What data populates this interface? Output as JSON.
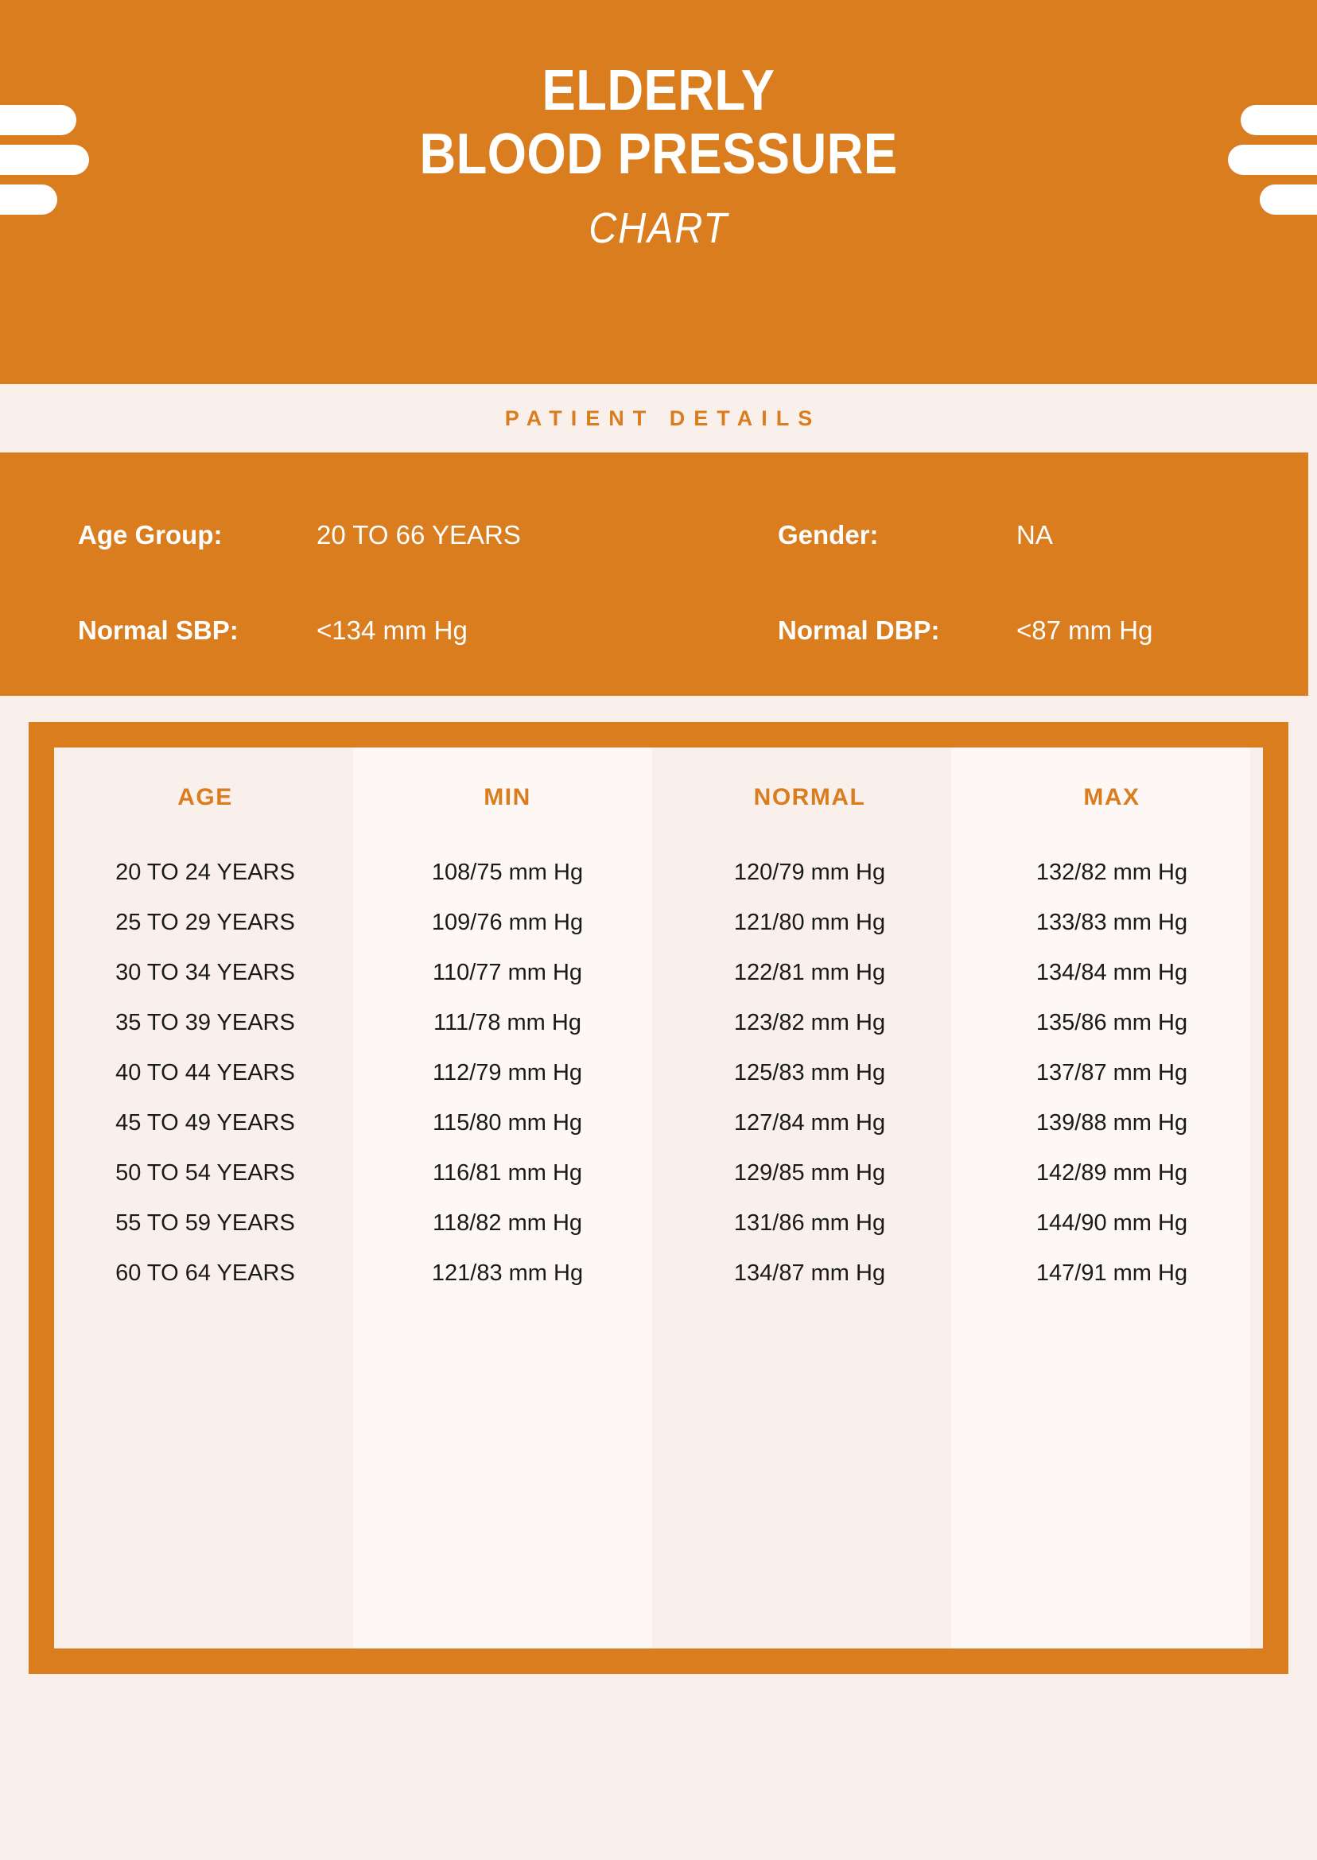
{
  "theme": {
    "orange": "#D97D1F",
    "cream": "#FAF0EB",
    "cream_light": "#FDF8F5",
    "white": "#FFFFFF",
    "text": "#1A1A1A"
  },
  "header": {
    "title_line1": "ELDERLY",
    "title_line2": "BLOOD PRESSURE",
    "subtitle": "CHART",
    "decor_left": "stacked-bars-decoration",
    "decor_right": "stacked-bars-decoration"
  },
  "patient_details": {
    "section_label": "PATIENT DETAILS",
    "fields": [
      {
        "label": "Age Group:",
        "value": "20 TO 66 YEARS"
      },
      {
        "label": "Gender:",
        "value": "NA"
      },
      {
        "label": "Normal SBP:",
        "value": "<134 mm Hg"
      },
      {
        "label": "Normal DBP:",
        "value": "<87 mm Hg"
      }
    ]
  },
  "chart_data": {
    "type": "table",
    "title": "ELDERLY BLOOD PRESSURE CHART",
    "columns": [
      "AGE",
      "MIN",
      "NORMAL",
      "MAX"
    ],
    "rows": [
      [
        "20 TO 24 YEARS",
        "108/75 mm Hg",
        "120/79 mm Hg",
        "132/82 mm Hg"
      ],
      [
        "25 TO 29 YEARS",
        "109/76 mm Hg",
        "121/80 mm Hg",
        "133/83 mm Hg"
      ],
      [
        "30 TO 34 YEARS",
        "110/77 mm Hg",
        "122/81 mm Hg",
        "134/84 mm Hg"
      ],
      [
        "35 TO 39 YEARS",
        "111/78 mm Hg",
        "123/82 mm Hg",
        "135/86 mm Hg"
      ],
      [
        "40 TO 44 YEARS",
        "112/79 mm Hg",
        "125/83 mm Hg",
        "137/87 mm Hg"
      ],
      [
        "45 TO 49 YEARS",
        "115/80 mm Hg",
        "127/84 mm Hg",
        "139/88 mm Hg"
      ],
      [
        "50 TO 54 YEARS",
        "116/81 mm Hg",
        "129/85 mm Hg",
        "142/89 mm Hg"
      ],
      [
        "55 TO 59 YEARS",
        "118/82 mm Hg",
        "131/86 mm Hg",
        "144/90 mm Hg"
      ],
      [
        "60 TO 64 YEARS",
        "121/83 mm Hg",
        "134/87 mm Hg",
        "147/91 mm Hg"
      ]
    ],
    "series": [
      {
        "name": "MIN systolic",
        "categories_key": "age_groups",
        "values": [
          108,
          109,
          110,
          111,
          112,
          115,
          116,
          118,
          121
        ]
      },
      {
        "name": "MIN diastolic",
        "categories_key": "age_groups",
        "values": [
          75,
          76,
          77,
          78,
          79,
          80,
          81,
          82,
          83
        ]
      },
      {
        "name": "NORMAL systolic",
        "categories_key": "age_groups",
        "values": [
          120,
          121,
          122,
          123,
          125,
          127,
          129,
          131,
          134
        ]
      },
      {
        "name": "NORMAL diastolic",
        "categories_key": "age_groups",
        "values": [
          79,
          80,
          81,
          82,
          83,
          84,
          85,
          86,
          87
        ]
      },
      {
        "name": "MAX systolic",
        "categories_key": "age_groups",
        "values": [
          132,
          133,
          134,
          135,
          137,
          139,
          142,
          144,
          147
        ]
      },
      {
        "name": "MAX diastolic",
        "categories_key": "age_groups",
        "values": [
          82,
          83,
          84,
          86,
          87,
          88,
          89,
          90,
          91
        ]
      }
    ],
    "age_groups": [
      "20 TO 24 YEARS",
      "25 TO 29 YEARS",
      "30 TO 34 YEARS",
      "35 TO 39 YEARS",
      "40 TO 44 YEARS",
      "45 TO 49 YEARS",
      "50 TO 54 YEARS",
      "55 TO 59 YEARS",
      "60 TO 64 YEARS"
    ],
    "unit": "mm Hg",
    "xlabel": "AGE",
    "ylabel": "Blood Pressure (mm Hg)"
  }
}
